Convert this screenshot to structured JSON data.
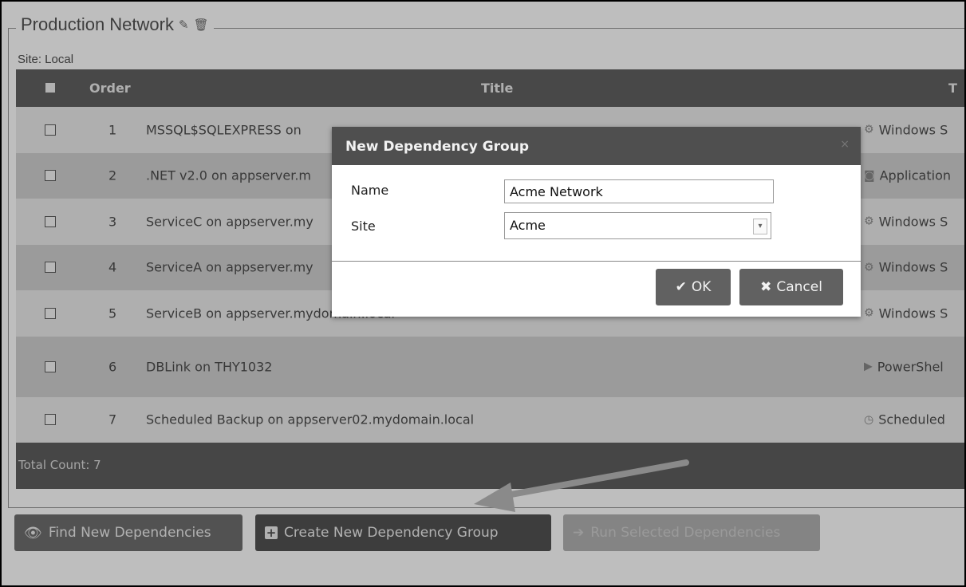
{
  "group": {
    "title": "Production Network",
    "edit_icon": "pencil-icon",
    "delete_icon": "trash-icon",
    "site_label": "Site: Local"
  },
  "table": {
    "headers": {
      "order": "Order",
      "title": "Title",
      "type": "T"
    },
    "rows": [
      {
        "order": "1",
        "title": "MSSQL$SQLEXPRESS on",
        "type": "Windows S",
        "type_icon": "gear-icon"
      },
      {
        "order": "2",
        "title": ".NET v2.0 on appserver.m",
        "type": "Application",
        "type_icon": "app-pool-icon"
      },
      {
        "order": "3",
        "title": "ServiceC on appserver.my",
        "type": "Windows S",
        "type_icon": "gear-icon"
      },
      {
        "order": "4",
        "title": "ServiceA on appserver.my",
        "type": "Windows S",
        "type_icon": "gear-icon"
      },
      {
        "order": "5",
        "title": "ServiceB on appserver.mydomain.local",
        "type": "Windows S",
        "type_icon": "gear-icon"
      },
      {
        "order": "6",
        "title": "DBLink on THY1032",
        "type": "PowerShel",
        "type_icon": "powershell-icon"
      },
      {
        "order": "7",
        "title": "Scheduled Backup on appserver02.mydomain.local",
        "type": "Scheduled",
        "type_icon": "clock-icon"
      }
    ],
    "footer": "Total Count: 7"
  },
  "modal": {
    "title": "New Dependency Group",
    "close": "×",
    "name_label": "Name",
    "name_value": "Acme Network",
    "site_label": "Site",
    "site_value": "Acme",
    "ok_label": "OK",
    "cancel_label": "Cancel"
  },
  "buttons": {
    "find": "Find New Dependencies",
    "create": "Create New Dependency Group",
    "run": "Run Selected Dependencies"
  }
}
